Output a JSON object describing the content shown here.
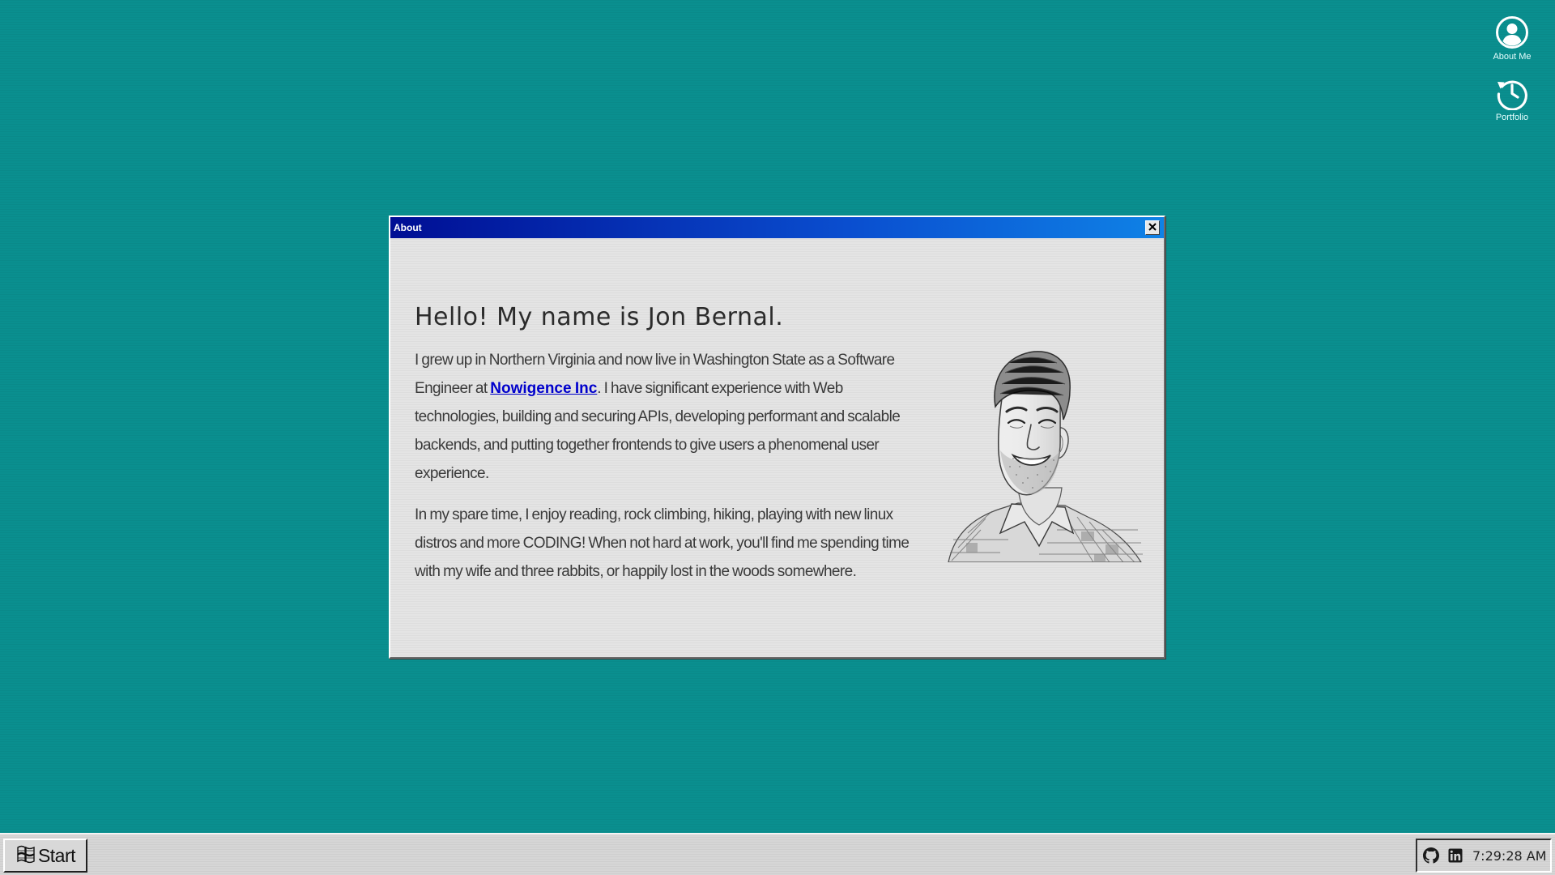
{
  "desktop": {
    "icons": [
      {
        "label": "About Me",
        "icon": "user-circle-icon"
      },
      {
        "label": "Portfolio",
        "icon": "history-icon"
      }
    ]
  },
  "window": {
    "title": "About",
    "close_icon": "close-icon",
    "heading": "Hello! My name is Jon Bernal.",
    "paragraph1": {
      "before_link": "I grew up in Northern Virginia and now live in Washington State as a Software Engineer at ",
      "link_text": "Nowigence Inc",
      "after_link": ". I have significant experience with Web technologies, building and securing APIs, developing performant and scalable backends, and putting together frontends to give users a phenomenal user experience."
    },
    "paragraph2": "In my spare time, I enjoy reading, rock climbing, hiking, playing with new linux distros and more CODING! When not hard at work, you'll find me spending time with my wife and three rabbits, or happily lost in the woods somewhere.",
    "portrait": "sketch-portrait"
  },
  "taskbar": {
    "start_label": "Start",
    "start_icon": "windows-flag-icon",
    "tray_icons": [
      "github-icon",
      "linkedin-icon"
    ],
    "clock": "7:29:28 AM"
  },
  "colors": {
    "desktop": "#0a8f8f",
    "titlebar_start": "#000e94",
    "titlebar_end": "#0f82e6",
    "link": "#0000cc",
    "window_bg": "#e4e4e4"
  }
}
